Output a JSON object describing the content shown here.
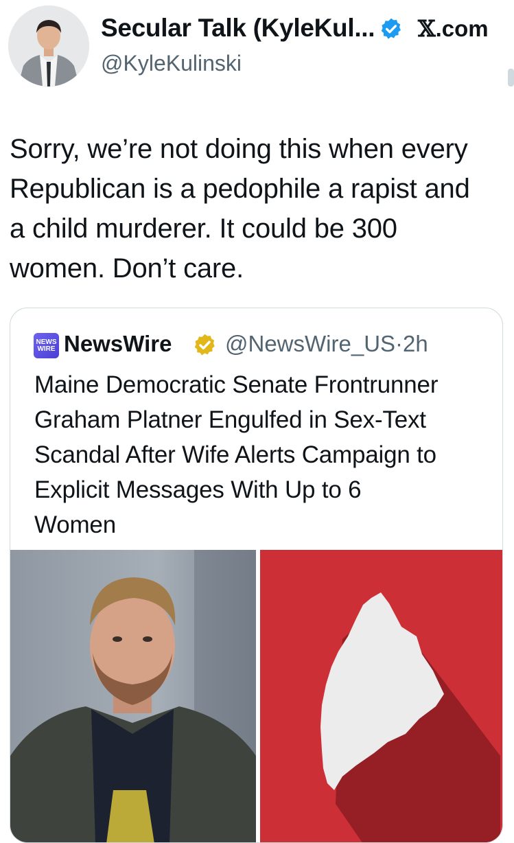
{
  "tweet": {
    "author_name": "Secular Talk (KyleKul...",
    "handle": "@KyleKulinski",
    "site_label": ".com",
    "site_glyph": "𝕏",
    "verified_color": "#1d9bf0",
    "body_lines": [
      "Sorry, we’re not doing this when every",
      "Republican is a pedophile a rapist and",
      "a child murderer. It could be 300",
      "women. Don’t care."
    ]
  },
  "quote": {
    "logo_lines": [
      "NEWS",
      "WIRE"
    ],
    "name": "NewsWire",
    "handle": "@NewsWire_US",
    "separator": "·",
    "time": "2h",
    "verified_color": "#e2b719",
    "headline_lines": [
      "Maine Democratic Senate Frontrunner",
      "Graham Platner Engulfed in Sex-Text",
      "Scandal After Wife Alerts Campaign to",
      "Explicit Messages With Up to 6",
      "Women"
    ]
  },
  "images": {
    "left": "portrait-photo",
    "right": "maine-map-graphic",
    "right_background": "#cc3036",
    "map_fill": "#ececec"
  }
}
